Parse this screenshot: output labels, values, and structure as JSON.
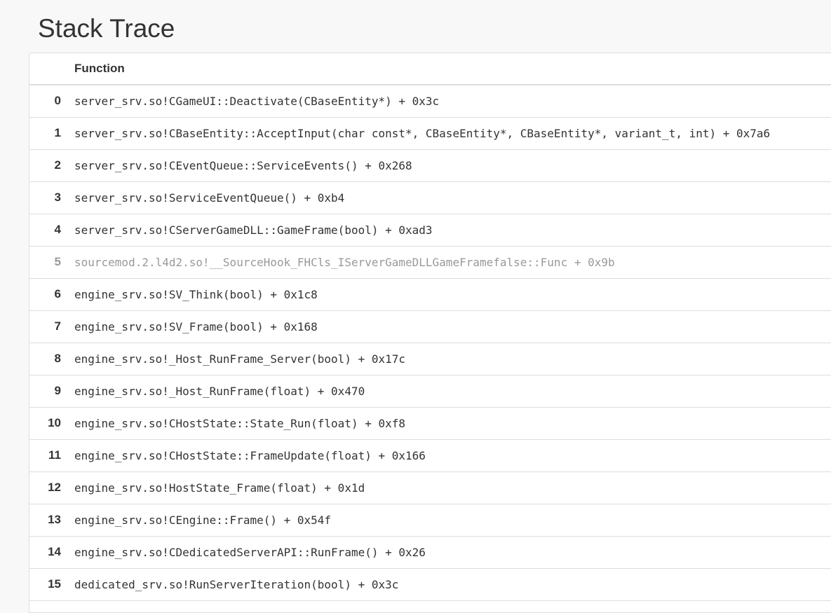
{
  "page_title": "Stack Trace",
  "table": {
    "header_function": "Function",
    "rows": [
      {
        "index": "0",
        "function": "server_srv.so!CGameUI::Deactivate(CBaseEntity*) + 0x3c",
        "muted": false
      },
      {
        "index": "1",
        "function": "server_srv.so!CBaseEntity::AcceptInput(char const*, CBaseEntity*, CBaseEntity*, variant_t, int) + 0x7a6",
        "muted": false
      },
      {
        "index": "2",
        "function": "server_srv.so!CEventQueue::ServiceEvents() + 0x268",
        "muted": false
      },
      {
        "index": "3",
        "function": "server_srv.so!ServiceEventQueue() + 0xb4",
        "muted": false
      },
      {
        "index": "4",
        "function": "server_srv.so!CServerGameDLL::GameFrame(bool) + 0xad3",
        "muted": false
      },
      {
        "index": "5",
        "function": "sourcemod.2.l4d2.so!__SourceHook_FHCls_IServerGameDLLGameFramefalse::Func + 0x9b",
        "muted": true
      },
      {
        "index": "6",
        "function": "engine_srv.so!SV_Think(bool) + 0x1c8",
        "muted": false
      },
      {
        "index": "7",
        "function": "engine_srv.so!SV_Frame(bool) + 0x168",
        "muted": false
      },
      {
        "index": "8",
        "function": "engine_srv.so!_Host_RunFrame_Server(bool) + 0x17c",
        "muted": false
      },
      {
        "index": "9",
        "function": "engine_srv.so!_Host_RunFrame(float) + 0x470",
        "muted": false
      },
      {
        "index": "10",
        "function": "engine_srv.so!CHostState::State_Run(float) + 0xf8",
        "muted": false
      },
      {
        "index": "11",
        "function": "engine_srv.so!CHostState::FrameUpdate(float) + 0x166",
        "muted": false
      },
      {
        "index": "12",
        "function": "engine_srv.so!HostState_Frame(float) + 0x1d",
        "muted": false
      },
      {
        "index": "13",
        "function": "engine_srv.so!CEngine::Frame() + 0x54f",
        "muted": false
      },
      {
        "index": "14",
        "function": "engine_srv.so!CDedicatedServerAPI::RunFrame() + 0x26",
        "muted": false
      },
      {
        "index": "15",
        "function": "dedicated_srv.so!RunServerIteration(bool) + 0x3c",
        "muted": false
      }
    ]
  },
  "colors": {
    "text": "#333333",
    "muted_text": "#999999",
    "border": "#dddddd",
    "page_bg": "#f8f8f8",
    "panel_bg": "#ffffff"
  }
}
